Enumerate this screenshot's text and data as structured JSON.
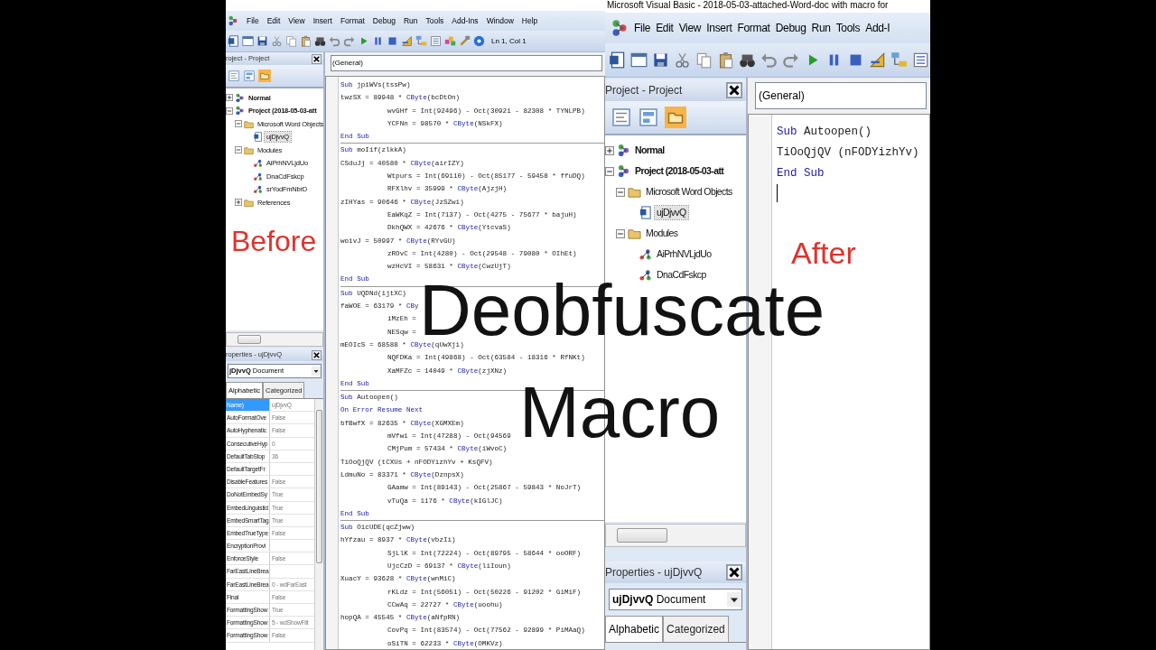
{
  "before": {
    "label": "Before",
    "menu": [
      "File",
      "Edit",
      "View",
      "Insert",
      "Format",
      "Debug",
      "Run",
      "Tools",
      "Add-Ins",
      "Window",
      "Help"
    ],
    "toolbar": {
      "position": "Ln 1, Col 1"
    },
    "project": {
      "title": "roject - Project",
      "tree": [
        {
          "label": "Normal",
          "kind": "project",
          "expanded": false,
          "selected": false
        },
        {
          "label": "Project (2018-05-03-att",
          "kind": "project",
          "expanded": true,
          "selected": false,
          "children": [
            {
              "label": "Microsoft Word Objects",
              "kind": "folder",
              "expanded": true,
              "selected": false,
              "children": [
                {
                  "label": "ujDjvvQ",
                  "kind": "document",
                  "selected": true
                }
              ]
            },
            {
              "label": "Modules",
              "kind": "folder",
              "expanded": true,
              "selected": false,
              "children": [
                {
                  "label": "AiPrhNVLjdUo",
                  "kind": "module",
                  "selected": false
                },
                {
                  "label": "DnaCdFskcp",
                  "kind": "module",
                  "selected": false
                },
                {
                  "label": "srYodFmNbrD",
                  "kind": "module",
                  "selected": false
                }
              ]
            },
            {
              "label": "References",
              "kind": "folder",
              "expanded": false,
              "selected": false
            }
          ]
        }
      ]
    },
    "properties": {
      "title": "roperties - ujDjvvQ",
      "object": "**jDjvvQ** Document",
      "tabs": [
        {
          "label": "Alphabetic",
          "selected": true
        },
        {
          "label": "Categorized",
          "selected": false
        }
      ],
      "rows": [
        {
          "name": "Name)",
          "value": "ujDjvvQ",
          "selected": true
        },
        {
          "name": "AutoFormatOve",
          "value": "False",
          "selected": false
        },
        {
          "name": "AutoHyphenatic",
          "value": "False",
          "selected": false
        },
        {
          "name": "ConsecutiveHyp",
          "value": "0",
          "selected": false
        },
        {
          "name": "DefaultTabStop",
          "value": "36",
          "selected": false
        },
        {
          "name": "DefaultTargetFr",
          "selected": false
        },
        {
          "name": "DisableFeatures",
          "value": "False",
          "selected": false
        },
        {
          "name": "DoNotEmbedSy",
          "value": "True",
          "selected": false
        },
        {
          "name": "EmbedLinguistid",
          "value": "True",
          "selected": false
        },
        {
          "name": "EmbedSmartTag",
          "value": "True",
          "selected": false
        },
        {
          "name": "EmbedTrueType",
          "value": "False",
          "selected": false
        },
        {
          "name": "EncryptionProvi",
          "selected": false
        },
        {
          "name": "EnforceStyle",
          "value": "False",
          "selected": false
        },
        {
          "name": "FarEastLineBrea",
          "selected": false
        },
        {
          "name": "FarEastLineBrea",
          "value": "0 - wdFarEast",
          "selected": false
        },
        {
          "name": "Final",
          "value": "False",
          "selected": false
        },
        {
          "name": "FormattingShow",
          "value": "True",
          "selected": false
        },
        {
          "name": "FormattingShow",
          "value": "5 - wdShowFilt",
          "selected": false
        },
        {
          "name": "FormattingShow",
          "value": "False",
          "selected": false
        }
      ]
    },
    "code": {
      "object": "(General)",
      "procedures": [
        {
          "lines": [
            {
              "indent": false,
              "kw_first": true,
              "segs": [
                "Sub",
                " jpiWVs(tssPw)"
              ]
            },
            {
              "indent": false,
              "kw_first": false,
              "segs": [
                "twzSX = 89948 * ",
                "CByte",
                "(bcDtOn)"
              ]
            },
            {
              "indent": true,
              "kw_first": false,
              "segs": [
                "wvGHf = Int(92496) - Oct(30921 - 82308 * TYNLPB)"
              ]
            },
            {
              "indent": true,
              "kw_first": false,
              "segs": [
                "YCFNn = 98570 * ",
                "CByte",
                "(NSkFX)"
              ]
            },
            {
              "indent": false,
              "kw_first": true,
              "segs": [
                "End Sub"
              ]
            }
          ]
        },
        {
          "lines": [
            {
              "indent": false,
              "kw_first": true,
              "segs": [
                "Sub",
                " moIif(zlkkA)"
              ]
            },
            {
              "indent": false,
              "kw_first": false,
              "segs": [
                "CSduJj = 40580 * ",
                "CByte",
                "(airIZY)"
              ]
            },
            {
              "indent": true,
              "kw_first": false,
              "segs": [
                "Wtpurs = Int(69110) - Oct(85177 - 59458 * ffuDQ)"
              ]
            },
            {
              "indent": true,
              "kw_first": false,
              "segs": [
                "RFXlhv = 35999 * ",
                "CByte",
                "(AjzjH)"
              ]
            },
            {
              "indent": false,
              "kw_first": false,
              "segs": [
                "zIHYas = 90646 * ",
                "CByte",
                "(JzSZwi)"
              ]
            },
            {
              "indent": true,
              "kw_first": false,
              "segs": [
                "EaWKqZ = Int(7137) - Oct(4275 - 75677 * bajuH)"
              ]
            },
            {
              "indent": true,
              "kw_first": false,
              "segs": [
                "DkhQWX = 42676 * ",
                "CByte",
                "(YtcvaS)"
              ]
            },
            {
              "indent": false,
              "kw_first": false,
              "segs": [
                "woivJ = 50997 * ",
                "CByte",
                "(RYvGU)"
              ]
            },
            {
              "indent": true,
              "kw_first": false,
              "segs": [
                "zROvC = Int(4280) - Oct(29548 - 79080 * OIhEt)"
              ]
            },
            {
              "indent": true,
              "kw_first": false,
              "segs": [
                "wzHcVI = 58631 * ",
                "CByte",
                "(CwzUjT)"
              ]
            },
            {
              "indent": false,
              "kw_first": true,
              "segs": [
                "End Sub"
              ]
            }
          ]
        },
        {
          "lines": [
            {
              "indent": false,
              "kw_first": true,
              "segs": [
                "Sub",
                " UQDNd(ijtXC)"
              ]
            },
            {
              "indent": false,
              "kw_first": false,
              "segs": [
                "faWOE = 63179 * ",
                "CBy"
              ]
            },
            {
              "indent": true,
              "kw_first": false,
              "segs": [
                "iMzEh ="
              ]
            },
            {
              "indent": true,
              "kw_first": false,
              "segs": [
                "NESqw ="
              ]
            },
            {
              "indent": false,
              "kw_first": false,
              "segs": [
                "mEOIcS = 68588 * ",
                "CByte",
                "(qUwXji)"
              ]
            },
            {
              "indent": true,
              "kw_first": false,
              "segs": [
                "NQFDKa = Int(49868) - Oct(63584 - 18316 * RfNKt)"
              ]
            },
            {
              "indent": true,
              "kw_first": false,
              "segs": [
                "XaMFZc = 14049 * ",
                "CByte",
                "(zjXNz)"
              ]
            },
            {
              "indent": false,
              "kw_first": true,
              "segs": [
                "End Sub"
              ]
            }
          ]
        },
        {
          "lines": [
            {
              "indent": false,
              "kw_first": true,
              "segs": [
                "Sub",
                " Autoopen()"
              ]
            },
            {
              "indent": false,
              "kw_first": true,
              "segs": [
                "On Error Resume Next"
              ]
            },
            {
              "indent": false,
              "kw_first": false,
              "segs": [
                "bfBwfX = 82635 * ",
                "CByte",
                "(XGMXEm)"
              ]
            },
            {
              "indent": true,
              "kw_first": false,
              "segs": [
                "mVfwi = Int(47288) - Oct(94569"
              ]
            },
            {
              "indent": true,
              "kw_first": false,
              "segs": [
                "CMjPum = 57434 * ",
                "CByte",
                "(iWvoC)"
              ]
            },
            {
              "indent": false,
              "kw_first": false,
              "segs": [
                "TiOoQjQV (tCXUs + nFODYizhYv + KsQFV)"
              ]
            },
            {
              "indent": false,
              "kw_first": false,
              "segs": [
                "LdmuNo = 83371 * ",
                "CByte",
                "(DznpsX)"
              ]
            },
            {
              "indent": true,
              "kw_first": false,
              "segs": [
                "GAamw = Int(89143) - Oct(25867 - 59843 * NoJrT)"
              ]
            },
            {
              "indent": true,
              "kw_first": false,
              "segs": [
                "vTuQa = 1176 * ",
                "CByte",
                "(kIGlJC)"
              ]
            },
            {
              "indent": false,
              "kw_first": true,
              "segs": [
                "End Sub"
              ]
            }
          ]
        },
        {
          "lines": [
            {
              "indent": false,
              "kw_first": true,
              "segs": [
                "Sub",
                " OicUDE(qcZjww)"
              ]
            },
            {
              "indent": false,
              "kw_first": false,
              "segs": [
                "hYfzau = 8937 * ",
                "CByte",
                "(vbzIi)"
              ]
            },
            {
              "indent": true,
              "kw_first": false,
              "segs": [
                "SjLlK = Int(72224) - Oct(89795 - 58644 * ooORF)"
              ]
            },
            {
              "indent": true,
              "kw_first": false,
              "segs": [
                "UjcCzD = 69137 * ",
                "CByte",
                "(liIoun)"
              ]
            },
            {
              "indent": false,
              "kw_first": false,
              "segs": [
                "XuacY = 93628 * ",
                "CByte",
                "(wnMiC)"
              ]
            },
            {
              "indent": true,
              "kw_first": false,
              "segs": [
                "rKLdz = Int(56051) - Oct(50226 - 91202 * GiMiF)"
              ]
            },
            {
              "indent": true,
              "kw_first": false,
              "segs": [
                "CCwAq = 22727 * ",
                "CByte",
                "(uoohu)"
              ]
            },
            {
              "indent": false,
              "kw_first": false,
              "segs": [
                "hopQA = 45545 * ",
                "CByte",
                "(aNfpRN)"
              ]
            },
            {
              "indent": true,
              "kw_first": false,
              "segs": [
                "CovPq = Int(83574) - Oct(77562 - 92899 * PiMAaQ)"
              ]
            },
            {
              "indent": true,
              "kw_first": false,
              "segs": [
                "oSiTN = 62233 * ",
                "CByte",
                "(OMKVz)"
              ]
            }
          ]
        }
      ]
    }
  },
  "after": {
    "title": "Microsoft Visual Basic - 2018-05-03-attached-Word-doc with macro for",
    "label": "After",
    "menu": [
      "File",
      "Edit",
      "View",
      "Insert",
      "Format",
      "Debug",
      "Run",
      "Tools",
      "Add-I"
    ],
    "project": {
      "title": "Project - Project",
      "tree": [
        {
          "label": "Normal",
          "kind": "project",
          "expanded": false,
          "selected": false
        },
        {
          "label": "Project (2018-05-03-att",
          "kind": "project",
          "expanded": true,
          "selected": false,
          "children": [
            {
              "label": "Microsoft Word Objects",
              "kind": "folder",
              "expanded": true,
              "selected": false,
              "children": [
                {
                  "label": "ujDjvvQ",
                  "kind": "document",
                  "selected": true
                }
              ]
            },
            {
              "label": "Modules",
              "kind": "folder",
              "expanded": true,
              "selected": false,
              "children": [
                {
                  "label": "AiPrhNVLjdUo",
                  "kind": "module",
                  "selected": false
                },
                {
                  "label": "DnaCdFskcp",
                  "kind": "module",
                  "selected": false
                }
              ]
            }
          ]
        }
      ]
    },
    "properties": {
      "title": "Properties - ujDjvvQ",
      "object": "**ujDjvvQ** Document",
      "tabs": [
        {
          "label": "Alphabetic",
          "selected": true
        },
        {
          "label": "Categorized",
          "selected": false
        }
      ]
    },
    "code": {
      "object": "(General)",
      "procedures": [
        {
          "lines": [
            {
              "indent": false,
              "kw_first": true,
              "segs": [
                "Sub",
                " Autoopen()"
              ]
            },
            {
              "indent": false,
              "kw_first": false,
              "segs": [
                "TiOoQjQV (nFODYizhYv)"
              ]
            },
            {
              "indent": false,
              "kw_first": true,
              "segs": [
                "End Sub"
              ]
            }
          ]
        }
      ]
    }
  },
  "headline": [
    "Deobfuscate",
    "Macro"
  ]
}
